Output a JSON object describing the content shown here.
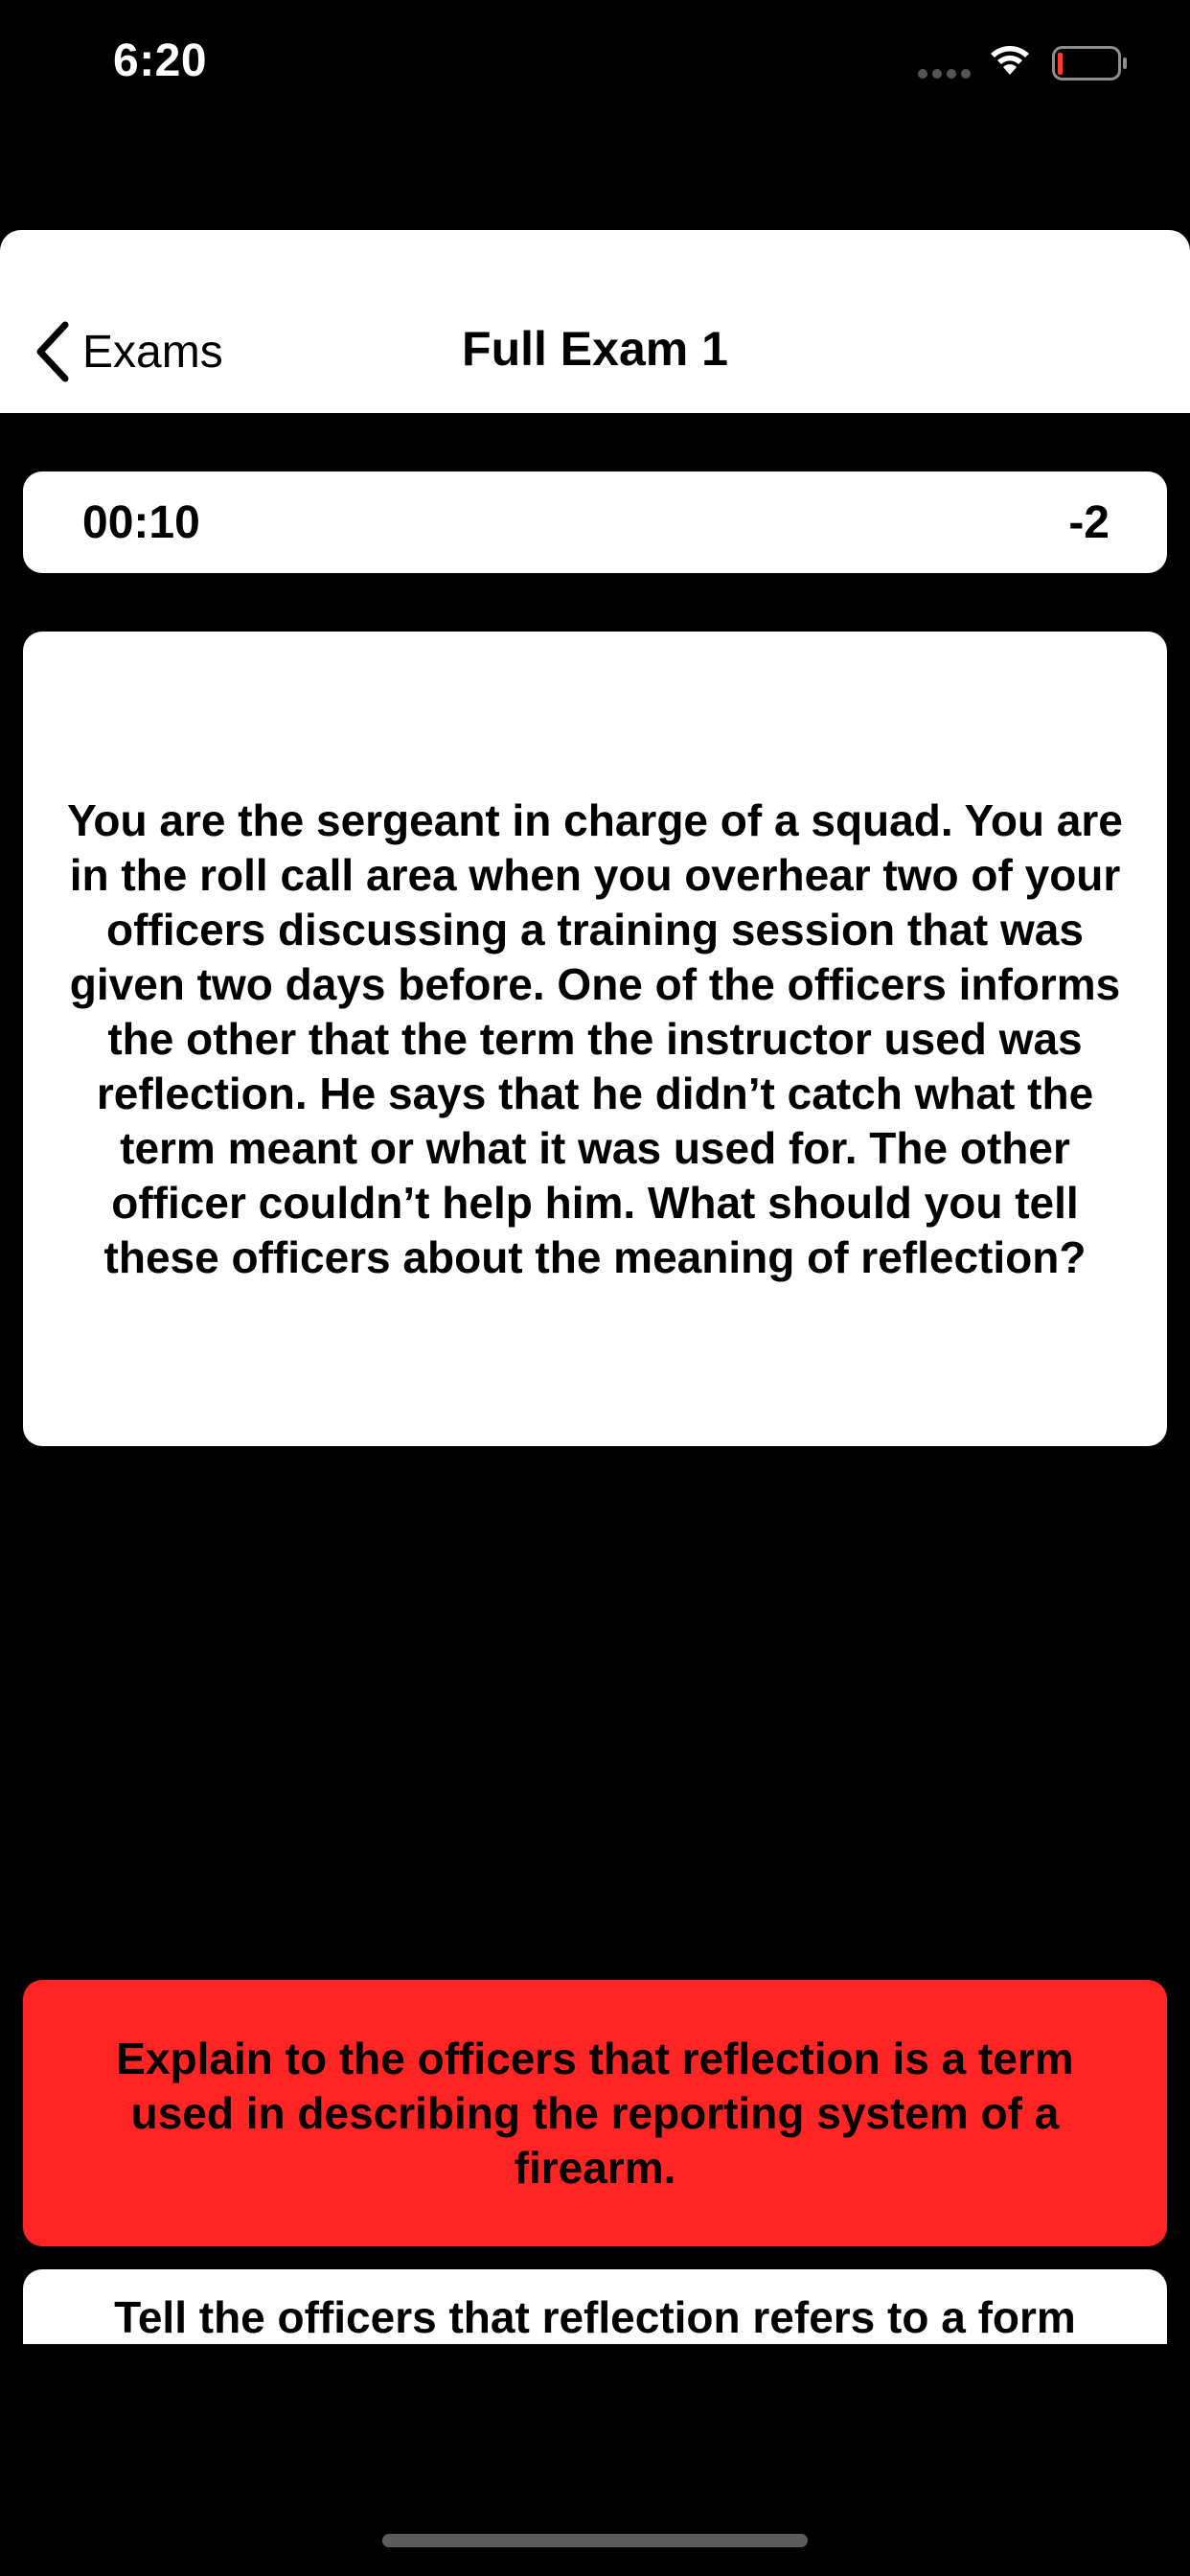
{
  "status_bar": {
    "time": "6:20"
  },
  "nav": {
    "back_label": "Exams",
    "title": "Full Exam 1"
  },
  "timer": {
    "elapsed": "00:10",
    "score": "-2"
  },
  "question": {
    "text": "You are the sergeant in charge of a squad. You are in the roll call area when you overhear two of your officers discussing a training session that was given two days before. One of the officers informs the other that the term the instructor used was reflection. He says that he didn’t catch what the term meant or what it was used for. The other officer couldn’t help him. What should you tell these officers about the meaning of reflection?"
  },
  "answers": [
    {
      "text": "Explain to the officers that reflection is a term used in describing the reporting system of a firearm.",
      "state": "incorrect",
      "color": "#ff2525"
    },
    {
      "text": "Tell the officers that reflection refers to a form",
      "state": "default",
      "color": "#ffffff"
    }
  ],
  "colors": {
    "background": "#000000",
    "card": "#ffffff",
    "wrong_answer": "#ff2525"
  }
}
